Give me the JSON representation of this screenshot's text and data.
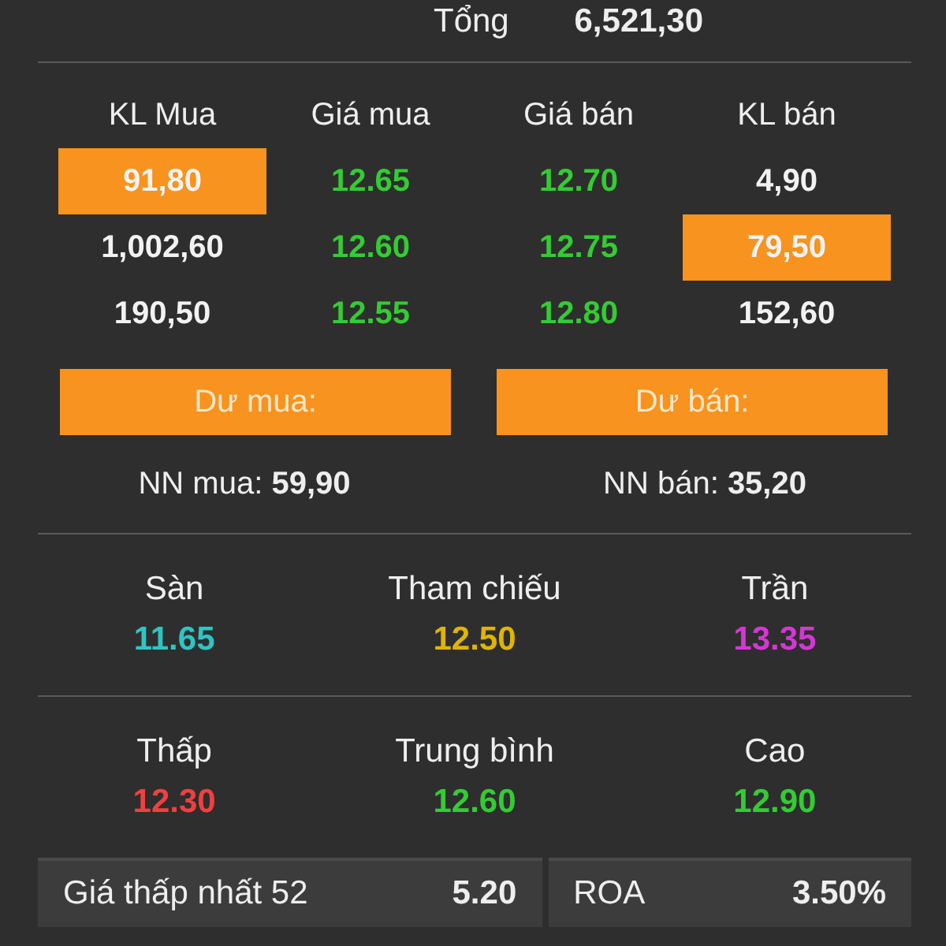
{
  "total": {
    "label": "Tổng",
    "value": "6,521,30"
  },
  "order_book": {
    "columns": [
      "KL Mua",
      "Giá mua",
      "Giá bán",
      "KL bán"
    ],
    "rows": [
      {
        "bid_volume": "91,80",
        "bid_volume_highlighted": true,
        "bid_price": "12.65",
        "ask_price": "12.70",
        "ask_volume": "4,90",
        "ask_volume_highlighted": false
      },
      {
        "bid_volume": "1,002,60",
        "bid_volume_highlighted": false,
        "bid_price": "12.60",
        "ask_price": "12.75",
        "ask_volume": "79,50",
        "ask_volume_highlighted": true
      },
      {
        "bid_volume": "190,50",
        "bid_volume_highlighted": false,
        "bid_price": "12.55",
        "ask_price": "12.80",
        "ask_volume": "152,60",
        "ask_volume_highlighted": false
      }
    ]
  },
  "surplus": [
    "Dư mua:",
    "Dư bán:"
  ],
  "foreign": [
    {
      "label": "NN mua:",
      "value": "59,90"
    },
    {
      "label": "NN bán:",
      "value": "35,20"
    }
  ],
  "price_groups": [
    [
      {
        "label": "Sàn",
        "value": "11.65",
        "color": "#2ec4c4"
      },
      {
        "label": "Tham chiếu",
        "value": "12.50",
        "color": "#e0b400"
      },
      {
        "label": "Trần",
        "value": "13.35",
        "color": "#d636d6"
      }
    ],
    [
      {
        "label": "Thấp",
        "value": "12.30",
        "color": "#f04040"
      },
      {
        "label": "Trung bình",
        "value": "12.60",
        "color": "#33cc33"
      },
      {
        "label": "Cao",
        "value": "12.90",
        "color": "#33cc33"
      }
    ]
  ],
  "bottom": [
    {
      "label": "Giá thấp nhất 52",
      "value": "5.20"
    },
    {
      "label": "ROA",
      "value": "3.50%"
    }
  ]
}
